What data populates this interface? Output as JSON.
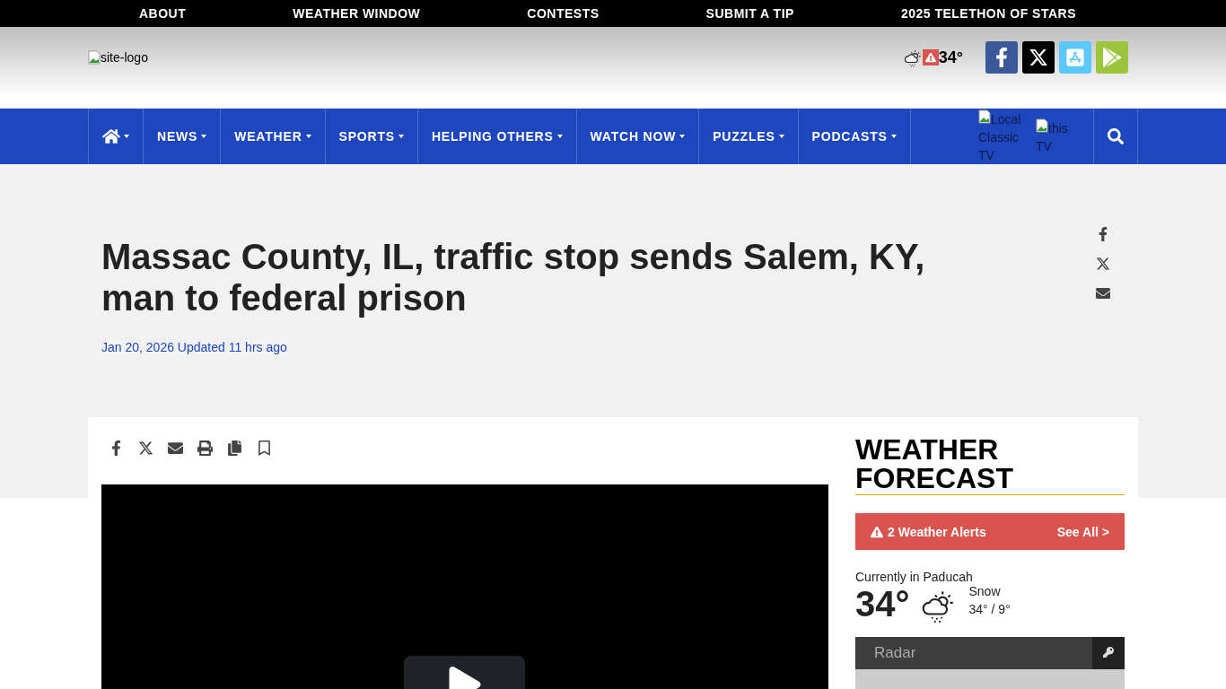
{
  "top_links": [
    "ABOUT",
    "WEATHER WINDOW",
    "CONTESTS",
    "SUBMIT A TIP",
    "2025 TELETHON OF STARS"
  ],
  "header": {
    "logo_alt": "site-logo",
    "temperature": "34°",
    "social": [
      {
        "kind": "facebook"
      },
      {
        "kind": "x"
      },
      {
        "kind": "appstore"
      },
      {
        "kind": "googleplay"
      }
    ]
  },
  "nav": {
    "items": [
      {
        "kind": "home"
      },
      {
        "kind": "link",
        "label": "NEWS"
      },
      {
        "kind": "link",
        "label": "WEATHER"
      },
      {
        "kind": "link",
        "label": "SPORTS"
      },
      {
        "kind": "link",
        "label": "HELPING OTHERS"
      },
      {
        "kind": "link",
        "label": "WATCH NOW"
      },
      {
        "kind": "link",
        "label": "PUZZLES"
      },
      {
        "kind": "link",
        "label": "PODCASTS"
      }
    ],
    "promos": [
      "Local Classic TV",
      "this TV"
    ]
  },
  "article": {
    "title": "Massac County, IL, traffic stop sends Salem, KY, man to federal prison",
    "dateline": "Jan 20, 2026 Updated 11 hrs ago",
    "side_share": [
      {
        "kind": "facebook"
      },
      {
        "kind": "x"
      },
      {
        "kind": "email"
      }
    ],
    "tools": [
      {
        "kind": "facebook"
      },
      {
        "kind": "x"
      },
      {
        "kind": "email"
      },
      {
        "kind": "print"
      },
      {
        "kind": "copy"
      },
      {
        "kind": "bookmark"
      }
    ]
  },
  "sidebar": {
    "heading": "WEATHER FORECAST",
    "alert": {
      "text": "2 Weather Alerts",
      "link": "See All >"
    },
    "current": {
      "label": "Currently in Paducah",
      "temp": "34°",
      "condition": "Snow",
      "range": "34° / 9°"
    },
    "radar": {
      "placeholder": "Radar"
    }
  }
}
